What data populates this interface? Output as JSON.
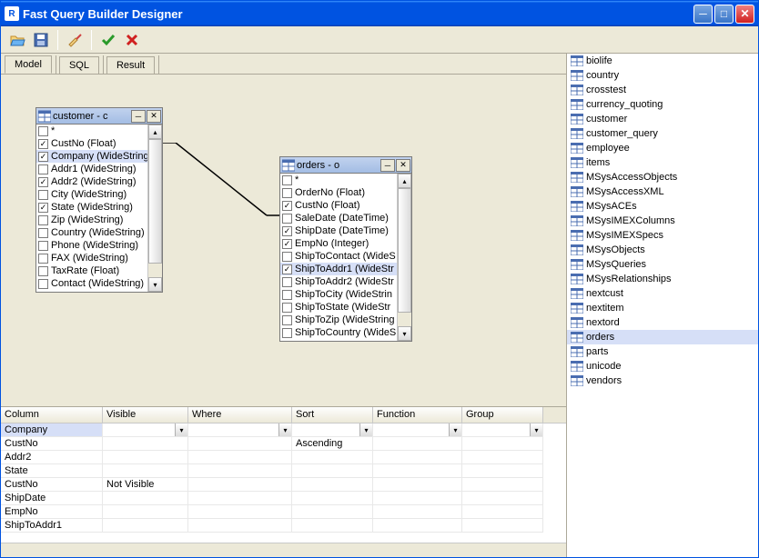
{
  "title": "Fast Query Builder  Designer",
  "tabs": [
    "Model",
    "SQL",
    "Result"
  ],
  "active_tab": 0,
  "tables": {
    "customer": {
      "title": "customer - c",
      "fields": [
        {
          "name": "*",
          "checked": false
        },
        {
          "name": "CustNo (Float)",
          "checked": true
        },
        {
          "name": "Company (WideString",
          "checked": true,
          "selected": true
        },
        {
          "name": "Addr1 (WideString)",
          "checked": false
        },
        {
          "name": "Addr2 (WideString)",
          "checked": true
        },
        {
          "name": "City (WideString)",
          "checked": false
        },
        {
          "name": "State (WideString)",
          "checked": true
        },
        {
          "name": "Zip (WideString)",
          "checked": false
        },
        {
          "name": "Country (WideString)",
          "checked": false
        },
        {
          "name": "Phone (WideString)",
          "checked": false
        },
        {
          "name": "FAX (WideString)",
          "checked": false
        },
        {
          "name": "TaxRate (Float)",
          "checked": false
        },
        {
          "name": "Contact (WideString)",
          "checked": false
        }
      ]
    },
    "orders": {
      "title": "orders - o",
      "fields": [
        {
          "name": "*",
          "checked": false
        },
        {
          "name": "OrderNo (Float)",
          "checked": false
        },
        {
          "name": "CustNo (Float)",
          "checked": true
        },
        {
          "name": "SaleDate (DateTime)",
          "checked": false
        },
        {
          "name": "ShipDate (DateTime)",
          "checked": true
        },
        {
          "name": "EmpNo (Integer)",
          "checked": true
        },
        {
          "name": "ShipToContact (WideS",
          "checked": false
        },
        {
          "name": "ShipToAddr1 (WideStr",
          "checked": true,
          "selected": true
        },
        {
          "name": "ShipToAddr2 (WideStr",
          "checked": false
        },
        {
          "name": "ShipToCity (WideStrin",
          "checked": false
        },
        {
          "name": "ShipToState (WideStr",
          "checked": false
        },
        {
          "name": "ShipToZip (WideString",
          "checked": false
        },
        {
          "name": "ShipToCountry (WideS",
          "checked": false
        }
      ]
    }
  },
  "grid": {
    "headers": [
      "Column",
      "Visible",
      "Where",
      "Sort",
      "Function",
      "Group"
    ],
    "rows": [
      {
        "col": "Company",
        "vis": "",
        "where": "",
        "sort": "",
        "func": "",
        "group": "",
        "selected": true,
        "dropdowns": true
      },
      {
        "col": "CustNo",
        "vis": "",
        "where": "",
        "sort": "Ascending",
        "func": "",
        "group": ""
      },
      {
        "col": "Addr2",
        "vis": "",
        "where": "",
        "sort": "",
        "func": "",
        "group": ""
      },
      {
        "col": "State",
        "vis": "",
        "where": "",
        "sort": "",
        "func": "",
        "group": ""
      },
      {
        "col": "CustNo",
        "vis": "Not Visible",
        "where": "",
        "sort": "",
        "func": "",
        "group": ""
      },
      {
        "col": "ShipDate",
        "vis": "",
        "where": "",
        "sort": "",
        "func": "",
        "group": ""
      },
      {
        "col": "EmpNo",
        "vis": "",
        "where": "",
        "sort": "",
        "func": "",
        "group": ""
      },
      {
        "col": "ShipToAddr1",
        "vis": "",
        "where": "",
        "sort": "",
        "func": "",
        "group": ""
      }
    ]
  },
  "tree": [
    "biolife",
    "country",
    "crosstest",
    "currency_quoting",
    "customer",
    "customer_query",
    "employee",
    "items",
    "MSysAccessObjects",
    "MSysAccessXML",
    "MSysACEs",
    "MSysIMEXColumns",
    "MSysIMEXSpecs",
    "MSysObjects",
    "MSysQueries",
    "MSysRelationships",
    "nextcust",
    "nextitem",
    "nextord",
    "orders",
    "parts",
    "unicode",
    "vendors"
  ],
  "tree_selected": "orders"
}
